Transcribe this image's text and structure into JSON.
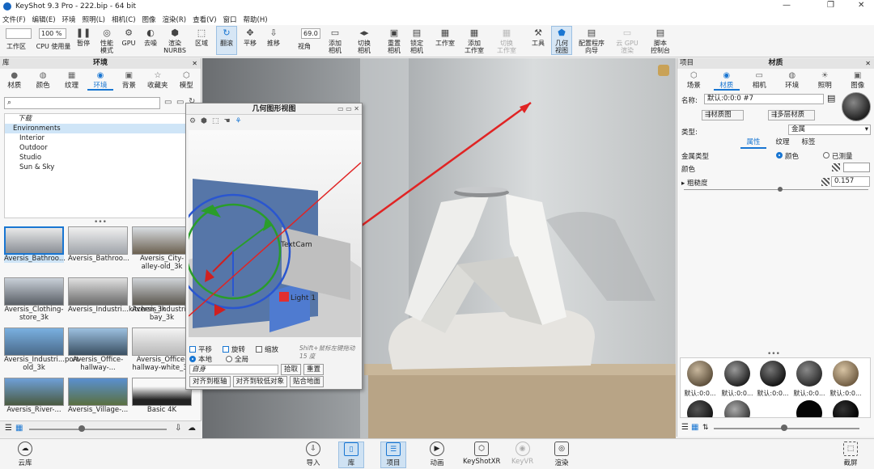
{
  "window": {
    "title": "KeyShot 9.3 Pro - 222.bip - 64 bit",
    "controls": [
      "—",
      "❐",
      "✕"
    ]
  },
  "menu": [
    "文件(F)",
    "编辑(E)",
    "环境",
    "照明(L)",
    "相机(C)",
    "图像",
    "渲染(R)",
    "查看(V)",
    "窗口",
    "帮助(H)"
  ],
  "toolbar": {
    "workspace_select": "",
    "zoom_select": "100 %",
    "fov_value": "69.0",
    "items": [
      {
        "label": "工作区",
        "icon": "workspace-icon"
      },
      {
        "label": "CPU 使用量",
        "icon": "cpu-icon"
      },
      {
        "label": "暂停",
        "icon": "pause-icon"
      },
      {
        "label": "性能\n模式",
        "icon": "performance-icon"
      },
      {
        "label": "GPU",
        "icon": "gpu-icon"
      },
      {
        "label": "去噪",
        "icon": "denoise-icon"
      },
      {
        "label": "渲染\nNURBS",
        "icon": "nurbs-icon"
      },
      {
        "label": "区域",
        "icon": "region-icon"
      },
      {
        "label": "翻滚",
        "icon": "tumble-icon"
      },
      {
        "label": "平移",
        "icon": "pan-icon"
      },
      {
        "label": "推移",
        "icon": "dolly-icon"
      },
      {
        "label": "视角",
        "icon": "fov-icon"
      },
      {
        "label": "添加\n相机",
        "icon": "add-camera-icon"
      },
      {
        "label": "切换\n相机",
        "icon": "switch-camera-icon"
      },
      {
        "label": "重置\n相机",
        "icon": "reset-camera-icon"
      },
      {
        "label": "锁定\n相机",
        "icon": "lock-camera-icon"
      },
      {
        "label": "工作室",
        "icon": "studio-icon"
      },
      {
        "label": "添加\n工作室",
        "icon": "add-studio-icon"
      },
      {
        "label": "切换\n工作室",
        "icon": "switch-studio-icon"
      },
      {
        "label": "工具",
        "icon": "tools-icon"
      },
      {
        "label": "几何\n视图",
        "icon": "geometry-view-icon"
      },
      {
        "label": "配置程序\n向导",
        "icon": "configurator-icon"
      },
      {
        "label": "云 GPU\n渲染",
        "icon": "cloud-gpu-icon"
      },
      {
        "label": "脚本\n控制台",
        "icon": "script-icon"
      }
    ]
  },
  "library": {
    "panel_label": "库",
    "title": "环境",
    "tabs": [
      "材质",
      "颜色",
      "纹理",
      "环境",
      "背景",
      "收藏夹",
      "模型"
    ],
    "active_tab": "环境",
    "search_value": "",
    "tree": [
      "下载",
      "Environments",
      "Interior",
      "Outdoor",
      "Studio",
      "Sun & Sky"
    ],
    "thumbs": [
      "Aversis_Bathroo...",
      "Aversis_Bathroo...",
      "Aversis_City-alley-old_3k",
      "Aversis_Clothing-store_3k",
      "Aversis_Industri...kitchen_3k",
      "Aversis_Industri...loading-bay_3k",
      "Aversis_Industri...port-old_3k",
      "Aversis_Office-hallway-...",
      "Aversis_Office-hallway-white_3k",
      "Aversis_River-...",
      "Aversis_Village-...",
      "Basic 4K"
    ]
  },
  "geo_view": {
    "title": "几何图形视图",
    "labels": [
      "TextCam",
      "Light 1"
    ],
    "translate": "平移",
    "rotate": "旋转",
    "scale": "缩放",
    "local": "本地",
    "global": "全局",
    "object_field": "自身",
    "hint": "Shift+鼠标左键拖动 15 度",
    "pick": "拾取",
    "reset": "重置",
    "align_axis": "对齐到枢轴",
    "align_lower": "对齐到较低对象",
    "snap_ground": "贴合地面"
  },
  "project": {
    "panel_label": "项目",
    "title": "材质",
    "tabs": [
      "场景",
      "材质",
      "相机",
      "环境",
      "照明",
      "图像"
    ],
    "active_tab": "材质",
    "name_label": "名称:",
    "name_value": "默认:0:0:0 #7",
    "graph_btn": "材质图",
    "multi_btn": "多层材质",
    "type_label": "类型:",
    "type_value": "金属",
    "subtabs": [
      "属性",
      "纹理",
      "标签"
    ],
    "metal_type_label": "金属类型",
    "metal_opt1": "颜色",
    "metal_opt2": "已测量",
    "color_label": "颜色",
    "rough_label": "粗糙度",
    "rough_value": "0.157",
    "balls": [
      "默认:0:0...",
      "默认:0:0...",
      "默认:0:0...",
      "默认:0:0...",
      "默认:0:0..."
    ]
  },
  "bottom": {
    "cloud": "云库",
    "items": [
      "导入",
      "库",
      "项目",
      "动画",
      "KeyShotXR",
      "KeyVR",
      "渲染"
    ],
    "screenshot": "截屏"
  }
}
